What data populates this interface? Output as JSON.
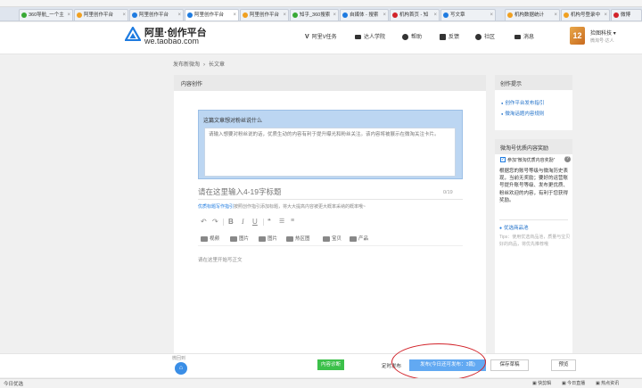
{
  "bookmarks": [
    "",
    "",
    "",
    "",
    "",
    "",
    "",
    "",
    ""
  ],
  "tabs": [
    {
      "label": "360导航_一个主",
      "active": false,
      "icon_color": "#39a935"
    },
    {
      "label": "阿里创作平台",
      "active": false,
      "icon_color": "#f0a020"
    },
    {
      "label": "阿里创作平台",
      "active": false,
      "icon_color": "#1e7be0"
    },
    {
      "label": "阿里创作平台",
      "active": true,
      "icon_color": "#1e7be0"
    },
    {
      "label": "阿里创作平台",
      "active": false,
      "icon_color": "#f0a020"
    },
    {
      "label": "知乎_360搜索",
      "active": false,
      "icon_color": "#39a935"
    },
    {
      "label": "自媒体 - 搜索",
      "active": false,
      "icon_color": "#1e7be0"
    },
    {
      "label": "机构首页 - 知",
      "active": false,
      "icon_color": "#d2232a"
    },
    {
      "label": "写文章",
      "active": false,
      "icon_color": "#1e7be0"
    },
    {
      "label": "机构数据统计",
      "active": false,
      "icon_color": "#f0a020"
    },
    {
      "label": "机构号登录中",
      "active": false,
      "icon_color": "#f0a020"
    },
    {
      "label": "微博",
      "active": false,
      "icon_color": "#d2232a"
    }
  ],
  "header": {
    "logo_title": "阿里·创作平台",
    "logo_url": "we.taobao.com",
    "nav": [
      {
        "label": "阿里V任务",
        "icon": "v-icon"
      },
      {
        "label": "达人学院",
        "icon": "graduation-cap-icon"
      },
      {
        "label": "帮助",
        "icon": "help-icon"
      },
      {
        "label": "反馈",
        "icon": "feedback-icon"
      },
      {
        "label": "社区",
        "icon": "community-icon"
      },
      {
        "label": "消息",
        "icon": "mail-icon"
      }
    ],
    "user_name": "捡图科技",
    "user_sub": "微淘号·达人",
    "avatar_text": "12"
  },
  "breadcrumb": {
    "first": "发布新微淘",
    "second": "长文章"
  },
  "editor": {
    "section_title": "内容创作",
    "card_label": "这篇文章想对粉丝说什么",
    "card_placeholder": "请输入想要对粉丝说的话，优质生动的内容有利于提升曝光和粉丝关注。该内容将被展示在微淘关注卡片。",
    "title_placeholder": "请在这里输入4-19字标题",
    "title_count": "0/19",
    "tip_link": "优质标题写作指引",
    "tip_text": "按照创作指引添加标题，将大大提高内容被更大概率采纳的概率哦~",
    "toolbar": {
      "undo": "↶",
      "redo": "↷",
      "bold": "B",
      "italic": "I",
      "underline": "U"
    },
    "insert": [
      {
        "label": "视频",
        "icon": "video-icon"
      },
      {
        "label": "图片",
        "icon": "image-icon"
      },
      {
        "label": "图片",
        "icon": "image-icon"
      },
      {
        "label": "热区图",
        "icon": "hotspot-icon"
      },
      {
        "label": "宝贝",
        "icon": "item-icon"
      },
      {
        "label": "产品",
        "icon": "product-icon"
      }
    ],
    "body_placeholder": "请在这里开始写正文"
  },
  "sidebar": {
    "tips_title": "创作提示",
    "tips_links": [
      "创作平台发布指引",
      "微淘话题内容规则"
    ],
    "reward_title": "微淘号优质内容奖励",
    "join_label": "参加“微淘优质内容奖励”",
    "reward_text": "根据您的账号等级与微淘历史表现，当前无奖励；要好的运营账号提升账号等级、发布更优质、粉丝欢迎的内容，有利于您获得奖励。",
    "sub_title": "优选商品池",
    "note": "Tips：使用优选商品池，质量与宝贝好的商品，将优先推荐哦"
  },
  "bottom": {
    "back_label": "微回到",
    "green_button": "内容诊断",
    "schedule": "定时发布",
    "publish": "发布(今日还可发布：3篇)",
    "draft": "保存草稿",
    "preview": "预览"
  },
  "statusbar": {
    "left": "今日优选",
    "right": [
      "快剪辑",
      "今日直播",
      "热点资讯"
    ]
  },
  "colors": {
    "accent": "#1e7be0",
    "publish": "#62a9f2",
    "green": "#3cc04a",
    "annotation": "#d2232a"
  }
}
